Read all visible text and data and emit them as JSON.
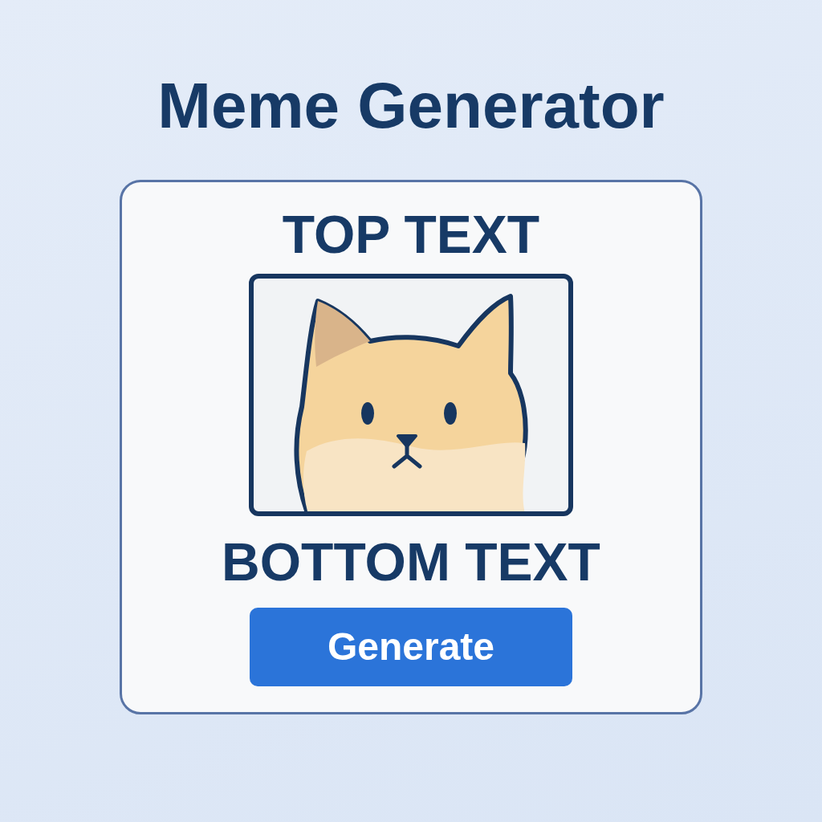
{
  "title": "Meme Generator",
  "meme": {
    "top_text": "TOP TEXT",
    "bottom_text": "BOTTOM TEXT"
  },
  "buttons": [
    {
      "label": "Generate"
    }
  ]
}
